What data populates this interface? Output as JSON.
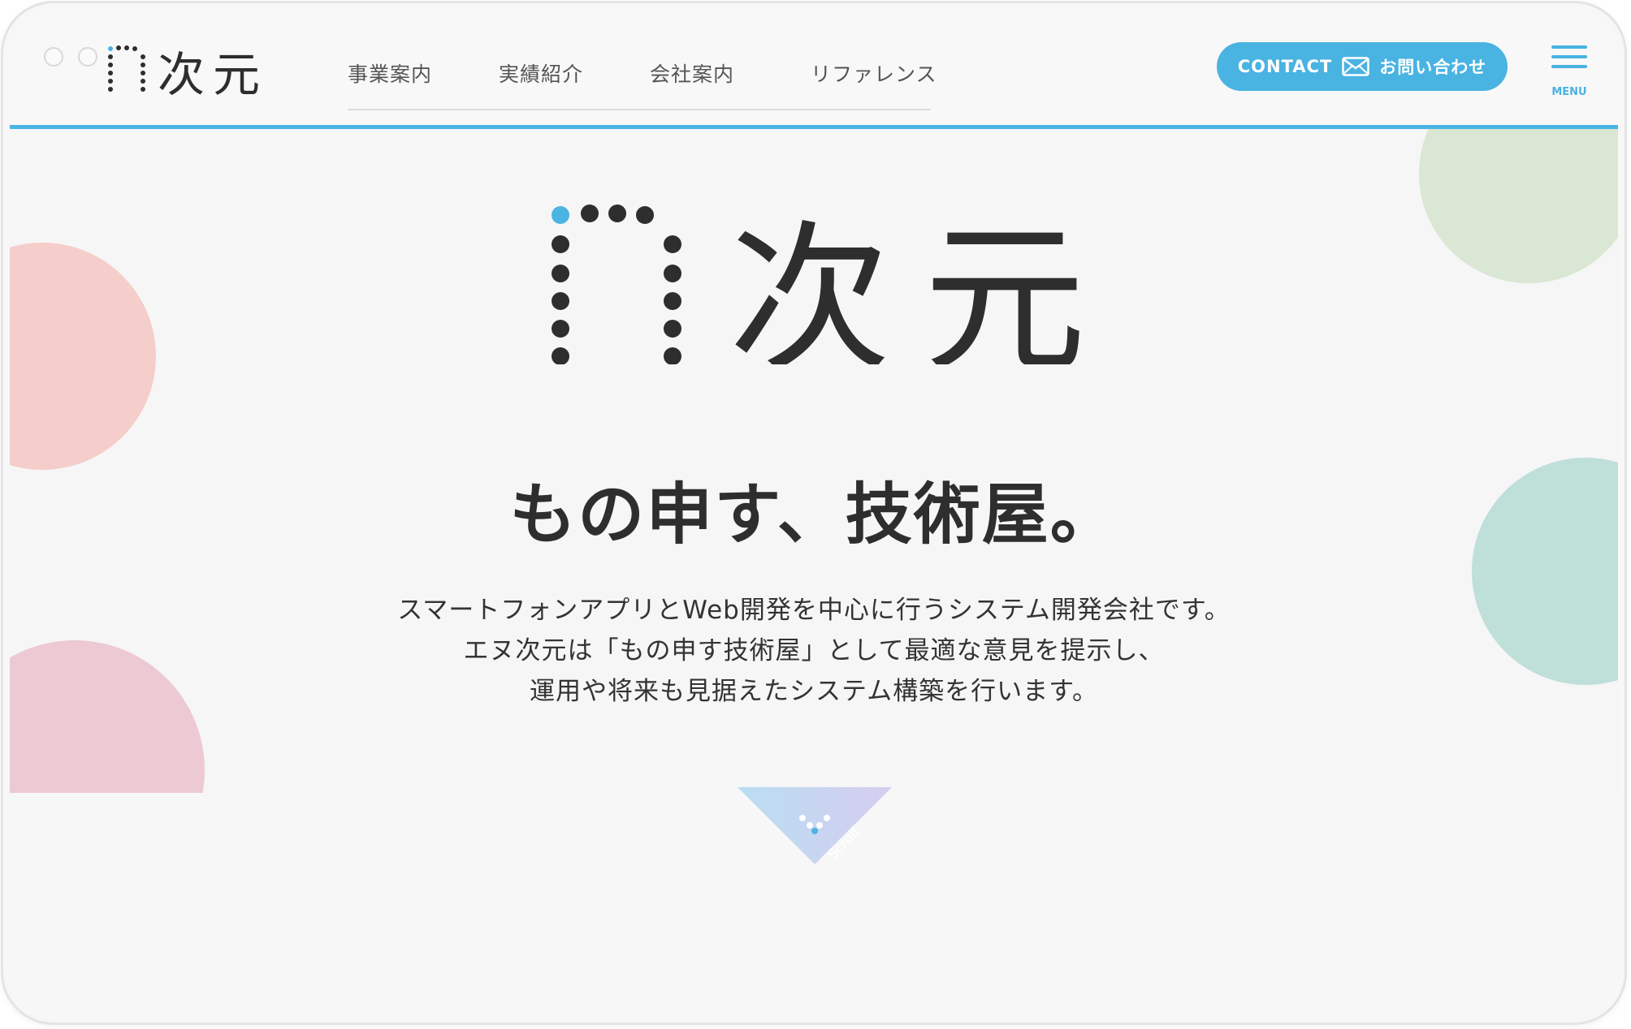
{
  "brand": {
    "logo_text": "次元",
    "logo_icon": "dotted-n-logo-icon",
    "accent": "#4ab4e3"
  },
  "nav": {
    "items": [
      {
        "label": "事業案内"
      },
      {
        "label": "実績紹介"
      },
      {
        "label": "会社案内"
      },
      {
        "label": "リファレンス"
      }
    ]
  },
  "contact": {
    "label_en": "CONTACT",
    "label_ja": "お問い合わせ",
    "icon": "mail-icon"
  },
  "menu": {
    "label": "MENU",
    "icon": "hamburger-icon"
  },
  "hero": {
    "tagline": "もの申す、技術屋。",
    "description": [
      "スマートフォンアプリとWeb開発を中心に行うシステム開発会社です。",
      "エヌ次元は「もの申す技術屋」として最適な意見を提示し、",
      "運用や将来も見据えたシステム構築を行います。"
    ]
  },
  "scroll": {
    "label": "Scroll",
    "icon": "scroll-down-icon"
  },
  "colors": {
    "circle_coral": "#f5cdca",
    "circle_pink": "#ecc9d3",
    "circle_green": "#d9e7d4",
    "circle_teal": "#bfdfd9",
    "text_dark": "#2e2e2e"
  }
}
